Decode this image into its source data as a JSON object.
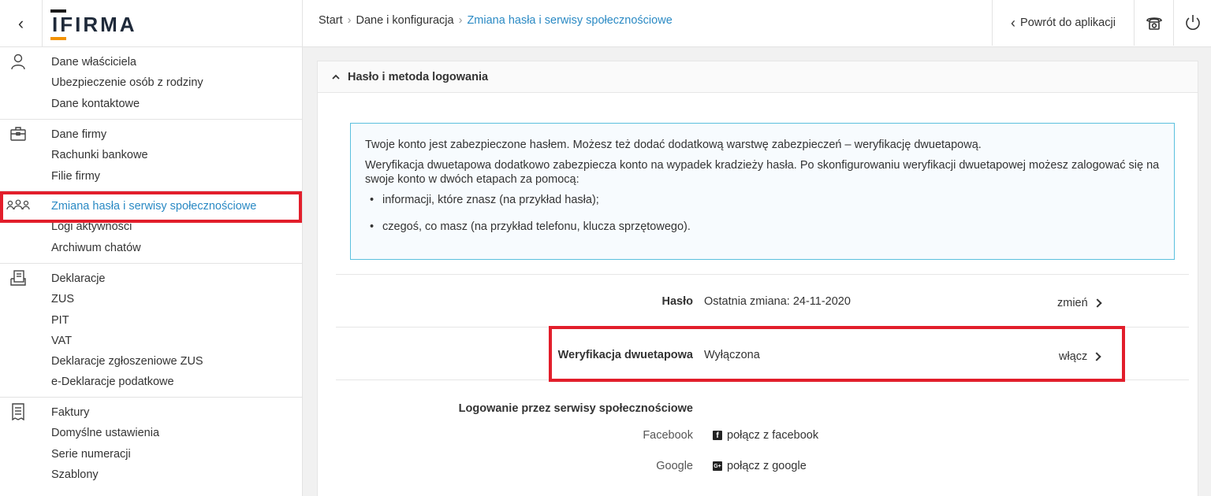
{
  "header": {
    "back_icon": "chevron-left-icon",
    "logo_text_1": "I",
    "logo_text_2": "FIRMA",
    "breadcrumb": [
      "Start",
      "Dane i konfiguracja",
      "Zmiana hasła i serwisy społecznościowe"
    ],
    "return_label": "Powrót do aplikacji",
    "phone_icon": "phone-icon",
    "power_icon": "power-icon"
  },
  "sidebar": {
    "groups": [
      {
        "icon": "user-icon",
        "items": [
          "Dane właściciela",
          "Ubezpieczenie osób z rodziny",
          "Dane kontaktowe"
        ]
      },
      {
        "icon": "briefcase-icon",
        "items": [
          "Dane firmy",
          "Rachunki bankowe",
          "Filie firmy"
        ]
      },
      {
        "icon": "people-icon",
        "items": [
          "Zmiana hasła i serwisy społecznościowe",
          "Logi aktywności",
          "Archiwum chatów"
        ]
      },
      {
        "icon": "documents-icon",
        "items": [
          "Deklaracje",
          "ZUS",
          "PIT",
          "VAT",
          "Deklaracje zgłoszeniowe ZUS",
          "e-Deklaracje podatkowe"
        ]
      },
      {
        "icon": "invoice-icon",
        "items": [
          "Faktury",
          "Domyślne ustawienia",
          "Serie numeracji",
          "Szablony"
        ]
      }
    ],
    "active_item": "Zmiana hasła i serwisy społecznościowe"
  },
  "panel": {
    "title": "Hasło i metoda logowania",
    "info": {
      "p1": "Twoje konto jest zabezpieczone hasłem. Możesz też dodać dodatkową warstwę zabezpieczeń – weryfikację dwuetapową.",
      "p2": "Weryfikacja dwuetapowa dodatkowo zabezpiecza konto na wypadek kradzieży hasła. Po skonfigurowaniu weryfikacji dwuetapowej możesz zalogować się na swoje konto w dwóch etapach za pomocą:",
      "bullet1": "informacji, które znasz (na przykład hasła);",
      "bullet2": "czegoś, co masz (na przykład telefonu, klucza sprzętowego)."
    },
    "password": {
      "label": "Hasło",
      "value": "Ostatnia zmiana: 24-11-2020",
      "action": "zmień"
    },
    "twofa": {
      "label": "Weryfikacja dwuetapowa",
      "value": "Wyłączona",
      "action": "włącz"
    },
    "social": {
      "label": "Logowanie przez serwisy społecznościowe",
      "facebook_label": "Facebook",
      "facebook_link": "połącz z facebook",
      "facebook_icon": "facebook-icon",
      "google_label": "Google",
      "google_link": "połącz z google",
      "google_icon": "google-plus-icon"
    }
  },
  "colors": {
    "accent": "#2b8ac4",
    "highlight": "#e21e2b",
    "info_border": "#5bc0de",
    "logo_orange": "#f39200"
  }
}
